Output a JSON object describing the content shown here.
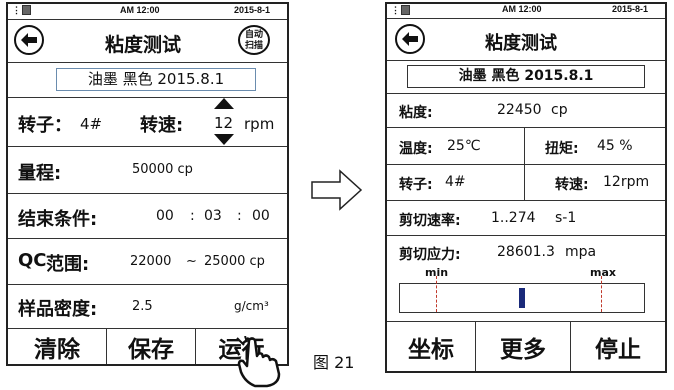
{
  "left": {
    "status": {
      "time": "AM 12:00",
      "date": "2015-8-1"
    },
    "title": "粘度测试",
    "auto_scan": {
      "line1": "自动",
      "line2": "扫描"
    },
    "sample": "油墨 黑色 2015.8.1",
    "rotor": {
      "label": "转子：",
      "value": "4#",
      "speed_label": "转速:",
      "speed_value": "12",
      "speed_unit": "rpm"
    },
    "range": {
      "label": "量程:",
      "value": "50000 cp"
    },
    "end": {
      "label": "结束条件:",
      "hh": "00",
      "sep1": ":",
      "mm": "03",
      "sep2": ":",
      "ss": "00"
    },
    "qc": {
      "label_prefix": "QC",
      "label": "范围:",
      "min": "22000",
      "tilde": "~",
      "max": "25000 cp"
    },
    "density": {
      "label": "样品密度:",
      "value": "2.5",
      "unit": "g/cm³"
    },
    "buttons": {
      "clear": "清除",
      "save": "保存",
      "run": "运行"
    }
  },
  "right": {
    "status": {
      "time": "AM 12:00",
      "date": "2015-8-1"
    },
    "title": "粘度测试",
    "sample": "油墨 黑色 2015.8.1",
    "viscosity": {
      "label": "粘度:",
      "value": "22450",
      "unit": "cp"
    },
    "temp": {
      "label": "温度:",
      "value": "25℃"
    },
    "torque": {
      "label": "扭矩:",
      "value": "45 %"
    },
    "rotor": {
      "label": "转子:",
      "value": "4#"
    },
    "speed": {
      "label": "转速:",
      "value": "12rpm"
    },
    "shear_rate": {
      "label": "剪切速率:",
      "value": "1..274",
      "unit": "s-1"
    },
    "shear_stress": {
      "label": "剪切应力:",
      "value": "28601.3",
      "unit": "mpa"
    },
    "gauge": {
      "min": "min",
      "max": "max",
      "level": 0.5
    },
    "buttons": {
      "coord": "坐标",
      "more": "更多",
      "stop": "停止"
    }
  },
  "caption": "图 21"
}
